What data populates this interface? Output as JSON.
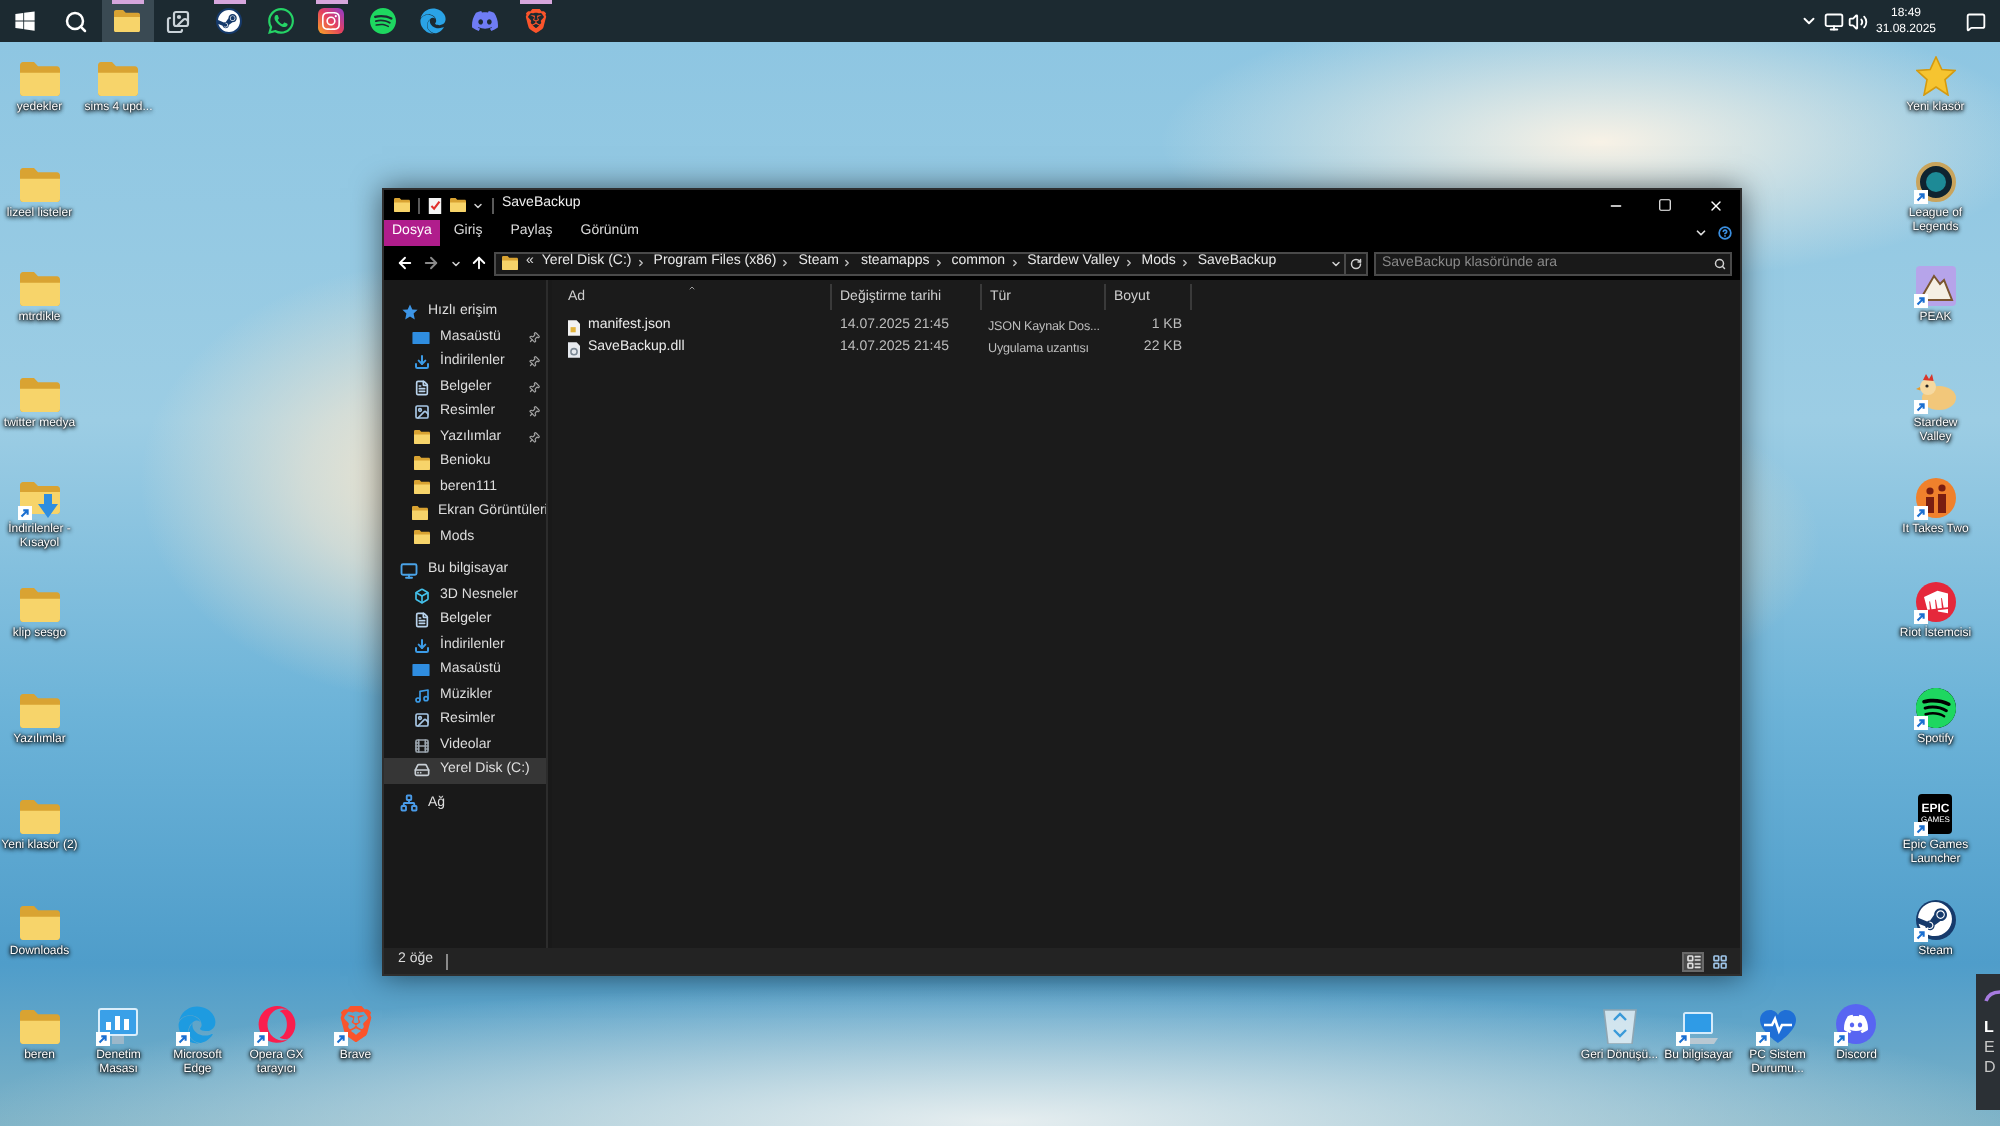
{
  "taskbar": {
    "apps": [
      {
        "kind": "start",
        "running": false,
        "selected": false
      },
      {
        "kind": "search",
        "running": false,
        "selected": false
      },
      {
        "kind": "explorer",
        "running": true,
        "selected": true
      },
      {
        "kind": "gallery",
        "running": false,
        "selected": false
      },
      {
        "kind": "steam",
        "running": true,
        "selected": false
      },
      {
        "kind": "whatsapp",
        "running": false,
        "selected": false
      },
      {
        "kind": "instagram",
        "running": true,
        "selected": false
      },
      {
        "kind": "spotify",
        "running": false,
        "selected": false
      },
      {
        "kind": "edge",
        "running": false,
        "selected": false
      },
      {
        "kind": "discord",
        "running": false,
        "selected": false
      },
      {
        "kind": "brave",
        "running": true,
        "selected": false
      }
    ],
    "tray": {
      "time": "18:49",
      "date": "31.08.2025"
    }
  },
  "desktop": {
    "left_column": [
      {
        "label": "yedekler",
        "kind": "folder",
        "shortcut": false
      },
      {
        "label": "lizeel listeler",
        "kind": "folder",
        "shortcut": false
      },
      {
        "label": "mtrdikle",
        "kind": "folder",
        "shortcut": false
      },
      {
        "label": "twitter medya",
        "kind": "folder",
        "shortcut": false
      },
      {
        "label": "İndirilenler - Kısayol",
        "kind": "downloads",
        "shortcut": true
      },
      {
        "label": "klip sesgo",
        "kind": "folder",
        "shortcut": false
      },
      {
        "label": "Yazılımlar",
        "kind": "folder",
        "shortcut": false
      },
      {
        "label": "Yeni klasör (2)",
        "kind": "folder",
        "shortcut": false
      },
      {
        "label": "Downloads",
        "kind": "folder",
        "shortcut": false
      },
      {
        "label": "beren",
        "kind": "folder",
        "shortcut": false
      }
    ],
    "second_column": [
      {
        "label": "sims 4 upd...",
        "kind": "folder",
        "shortcut": false
      },
      {
        "label": "Denetim Masası",
        "kind": "control_panel",
        "shortcut": true
      }
    ],
    "bottom_row": [
      {
        "label": "Microsoft Edge",
        "kind": "edge",
        "shortcut": true
      },
      {
        "label": "Opera GX tarayıcı",
        "kind": "opera",
        "shortcut": true
      },
      {
        "label": "Brave",
        "kind": "brave",
        "shortcut": true
      }
    ],
    "bottom_right_row": [
      {
        "label": "Geri Dönüşü...",
        "kind": "recycle",
        "shortcut": false
      },
      {
        "label": "Bu bilgisayar",
        "kind": "computer",
        "shortcut": true
      },
      {
        "label": "PC Sistem Durumu...",
        "kind": "health",
        "shortcut": true
      },
      {
        "label": "Discord",
        "kind": "discord",
        "shortcut": true
      }
    ],
    "right_column": [
      {
        "label": "Yeni klasör",
        "kind": "star",
        "shortcut": false
      },
      {
        "label": "League of Legends",
        "kind": "ring",
        "shortcut": true
      },
      {
        "label": "PEAK",
        "kind": "mountain",
        "shortcut": true
      },
      {
        "label": "Stardew Valley",
        "kind": "chicken",
        "shortcut": true
      },
      {
        "label": "It Takes Two",
        "kind": "figures",
        "shortcut": true
      },
      {
        "label": "Riot İstemcisi",
        "kind": "fist",
        "shortcut": true
      },
      {
        "label": "Spotify",
        "kind": "spotify",
        "shortcut": true
      },
      {
        "label": "Epic Games Launcher",
        "kind": "epic",
        "logo_text": [
          "EPIC",
          "GAMES"
        ],
        "shortcut": true
      },
      {
        "label": "Steam",
        "kind": "steam",
        "shortcut": true
      }
    ]
  },
  "explorer": {
    "title": "SaveBackup",
    "ribbon_tabs": [
      {
        "label": "Dosya",
        "selected": true
      },
      {
        "label": "Giriş",
        "selected": false
      },
      {
        "label": "Paylaş",
        "selected": false
      },
      {
        "label": "Görünüm",
        "selected": false
      }
    ],
    "address": {
      "overflow": "«",
      "path": [
        "Yerel Disk (C:)",
        "Program Files (x86)",
        "Steam",
        "steamapps",
        "common",
        "Stardew Valley",
        "Mods",
        "SaveBackup"
      ]
    },
    "search": {
      "placeholder": "SaveBackup klasöründe ara"
    },
    "navigation": [
      {
        "label": "Hızlı erişim",
        "kind": "star",
        "selected": false,
        "children": [
          {
            "label": "Masaüstü",
            "kind": "desktop",
            "pinned": true,
            "selected": false
          },
          {
            "label": "İndirilenler",
            "kind": "downloads",
            "pinned": true,
            "selected": false
          },
          {
            "label": "Belgeler",
            "kind": "documents",
            "pinned": true,
            "selected": false
          },
          {
            "label": "Resimler",
            "kind": "pictures",
            "pinned": true,
            "selected": false
          },
          {
            "label": "Yazılımlar",
            "kind": "folder",
            "pinned": true,
            "selected": false
          },
          {
            "label": "Benioku",
            "kind": "folder",
            "pinned": false,
            "selected": false
          },
          {
            "label": "beren111",
            "kind": "folder",
            "pinned": false,
            "selected": false
          },
          {
            "label": "Ekran Görüntüleri",
            "kind": "folder",
            "pinned": false,
            "selected": false
          },
          {
            "label": "Mods",
            "kind": "folder",
            "pinned": false,
            "selected": false
          }
        ]
      },
      {
        "label": "Bu bilgisayar",
        "kind": "computer",
        "selected": false,
        "children": [
          {
            "label": "3D Nesneler",
            "kind": "objects",
            "pinned": false,
            "selected": false
          },
          {
            "label": "Belgeler",
            "kind": "documents",
            "pinned": false,
            "selected": false
          },
          {
            "label": "İndirilenler",
            "kind": "downloads",
            "pinned": false,
            "selected": false
          },
          {
            "label": "Masaüstü",
            "kind": "desktop",
            "pinned": false,
            "selected": false
          },
          {
            "label": "Müzikler",
            "kind": "music",
            "pinned": false,
            "selected": false
          },
          {
            "label": "Resimler",
            "kind": "pictures",
            "pinned": false,
            "selected": false
          },
          {
            "label": "Videolar",
            "kind": "videos",
            "pinned": false,
            "selected": false
          },
          {
            "label": "Yerel Disk (C:)",
            "kind": "drive",
            "pinned": false,
            "selected": true
          }
        ]
      },
      {
        "label": "Ağ",
        "kind": "network",
        "selected": false
      }
    ],
    "columns": [
      {
        "label": "Ad",
        "sorted": true
      },
      {
        "label": "Değiştirme tarihi",
        "sorted": false
      },
      {
        "label": "Tür",
        "sorted": false
      },
      {
        "label": "Boyut",
        "sorted": false
      }
    ],
    "files": [
      {
        "name": "manifest.json",
        "kind": "json",
        "modified": "14.07.2025 21:45",
        "type": "JSON Kaynak Dos...",
        "size": "1 KB"
      },
      {
        "name": "SaveBackup.dll",
        "kind": "dll",
        "modified": "14.07.2025 21:45",
        "type": "Uygulama uzantısı",
        "size": "22 KB"
      }
    ],
    "status": "2 öğe",
    "views": [
      {
        "kind": "details",
        "selected": true
      },
      {
        "kind": "icons",
        "selected": false
      }
    ]
  },
  "notification": {
    "lines": [
      "L",
      "E",
      "D"
    ]
  }
}
